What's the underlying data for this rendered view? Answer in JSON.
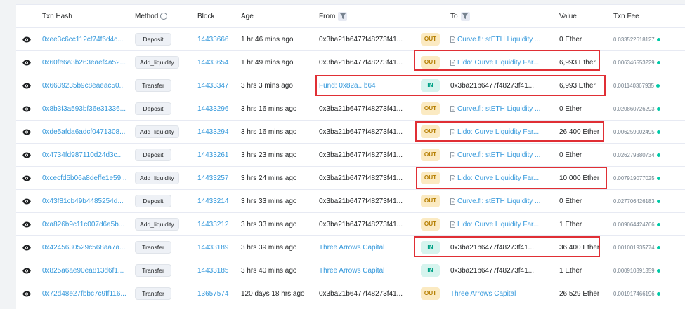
{
  "colors": {
    "link": "#3498db",
    "out_bg": "#fbeac2",
    "out_text": "#b47d00",
    "in_bg": "#d6f4ee",
    "in_text": "#00a186",
    "highlight": "#e02f35",
    "fee_dot": "#00c9a7"
  },
  "header": {
    "txn_hash": "Txn Hash",
    "method": "Method",
    "block": "Block",
    "age": "Age",
    "from": "From",
    "to": "To",
    "value": "Value",
    "txn_fee": "Txn Fee"
  },
  "rows": [
    {
      "hash": "0xee3c6cc112cf74f6d4c...",
      "method": "Deposit",
      "block": "14433666",
      "age": "1 hr 46 mins ago",
      "from": "0x3ba21b6477f48273f41...",
      "from_link": false,
      "dir": "OUT",
      "to": "Curve.fi: stETH Liquidity ...",
      "to_link": true,
      "value": "0 Ether",
      "fee": "0.033522618127"
    },
    {
      "hash": "0x60fe6a3b263eaef4a52...",
      "method": "Add_liquidity",
      "block": "14433654",
      "age": "1 hr 49 mins ago",
      "from": "0x3ba21b6477f48273f41...",
      "from_link": false,
      "dir": "OUT",
      "to": "Lido: Curve Liquidity Far...",
      "to_link": true,
      "value": "6,993 Ether",
      "fee": "0.006346553229"
    },
    {
      "hash": "0x6639235b9c8eaeac50...",
      "method": "Transfer",
      "block": "14433347",
      "age": "3 hrs 3 mins ago",
      "from": "Fund: 0x82a...b64",
      "from_link": true,
      "dir": "IN",
      "to": "0x3ba21b6477f48273f41...",
      "to_link": false,
      "value": "6,993 Ether",
      "fee": "0.001140367935"
    },
    {
      "hash": "0x8b3f3a593bf36e31336...",
      "method": "Deposit",
      "block": "14433296",
      "age": "3 hrs 16 mins ago",
      "from": "0x3ba21b6477f48273f41...",
      "from_link": false,
      "dir": "OUT",
      "to": "Curve.fi: stETH Liquidity ...",
      "to_link": true,
      "value": "0 Ether",
      "fee": "0.020860726293"
    },
    {
      "hash": "0xde5afda6adcf0471308...",
      "method": "Add_liquidity",
      "block": "14433294",
      "age": "3 hrs 16 mins ago",
      "from": "0x3ba21b6477f48273f41...",
      "from_link": false,
      "dir": "OUT",
      "to": "Lido: Curve Liquidity Far...",
      "to_link": true,
      "value": "26,400 Ether",
      "fee": "0.006259002495"
    },
    {
      "hash": "0x4734fd987110d24d3c...",
      "method": "Deposit",
      "block": "14433261",
      "age": "3 hrs 23 mins ago",
      "from": "0x3ba21b6477f48273f41...",
      "from_link": false,
      "dir": "OUT",
      "to": "Curve.fi: stETH Liquidity ...",
      "to_link": true,
      "value": "0 Ether",
      "fee": "0.026279380734"
    },
    {
      "hash": "0xcecfd5b06a8deffe1e59...",
      "method": "Add_liquidity",
      "block": "14433257",
      "age": "3 hrs 24 mins ago",
      "from": "0x3ba21b6477f48273f41...",
      "from_link": false,
      "dir": "OUT",
      "to": "Lido: Curve Liquidity Far...",
      "to_link": true,
      "value": "10,000 Ether",
      "fee": "0.007919077025"
    },
    {
      "hash": "0x43f81cb49b4485254d...",
      "method": "Deposit",
      "block": "14433214",
      "age": "3 hrs 33 mins ago",
      "from": "0x3ba21b6477f48273f41...",
      "from_link": false,
      "dir": "OUT",
      "to": "Curve.fi: stETH Liquidity ...",
      "to_link": true,
      "value": "0 Ether",
      "fee": "0.027706426183"
    },
    {
      "hash": "0xa826b9c11c007d6a5b...",
      "method": "Add_liquidity",
      "block": "14433212",
      "age": "3 hrs 33 mins ago",
      "from": "0x3ba21b6477f48273f41...",
      "from_link": false,
      "dir": "OUT",
      "to": "Lido: Curve Liquidity Far...",
      "to_link": true,
      "value": "1 Ether",
      "fee": "0.009064424766"
    },
    {
      "hash": "0x4245630529c568aa7a...",
      "method": "Transfer",
      "block": "14433189",
      "age": "3 hrs 39 mins ago",
      "from": "Three Arrows Capital",
      "from_link": true,
      "dir": "IN",
      "to": "0x3ba21b6477f48273f41...",
      "to_link": false,
      "value": "36,400 Ether",
      "fee": "0.001001935774"
    },
    {
      "hash": "0x825a6ae90ea813d6f1...",
      "method": "Transfer",
      "block": "14433185",
      "age": "3 hrs 40 mins ago",
      "from": "Three Arrows Capital",
      "from_link": true,
      "dir": "IN",
      "to": "0x3ba21b6477f48273f41...",
      "to_link": false,
      "value": "1 Ether",
      "fee": "0.000910391359"
    },
    {
      "hash": "0x72d48e27fbbc7c9ff116...",
      "method": "Transfer",
      "block": "13657574",
      "age": "120 days 18 hrs ago",
      "from": "0x3ba21b6477f48273f41...",
      "from_link": false,
      "dir": "OUT",
      "to": "Three Arrows Capital",
      "to_link": true,
      "value": "26,529 Ether",
      "fee": "0.001917466196"
    }
  ]
}
